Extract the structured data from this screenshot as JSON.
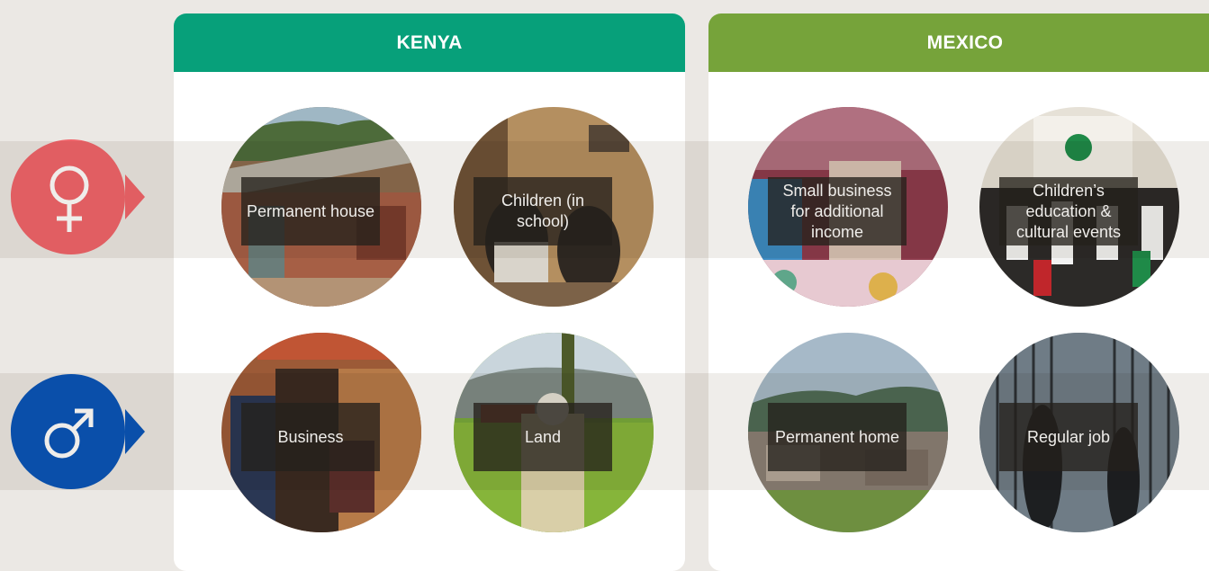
{
  "countries": {
    "kenya": {
      "name": "KENYA",
      "color": "#07a07a"
    },
    "mexico": {
      "name": "MEXICO",
      "color": "#76a33a"
    }
  },
  "genders": {
    "female": {
      "icon": "female-symbol-icon",
      "color": "#f0656b"
    },
    "male": {
      "icon": "male-symbol-icon",
      "color": "#0a55b9"
    }
  },
  "items": {
    "kenya_female_1": "Permanent house",
    "kenya_female_2": "Children (in school)",
    "mexico_female_1": "Small business for additional income",
    "mexico_female_2": "Children’s education & cultural events",
    "kenya_male_1": "Business",
    "kenya_male_2": "Land",
    "mexico_male_1": "Permanent home",
    "mexico_male_2": "Regular job"
  }
}
